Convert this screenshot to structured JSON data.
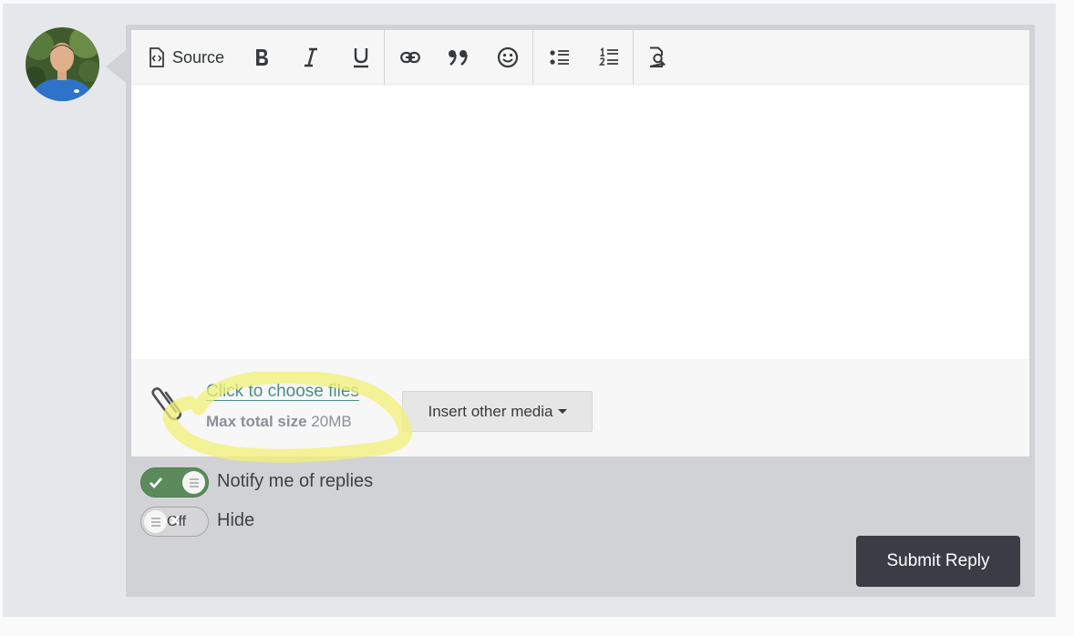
{
  "toolbar": {
    "source_label": "Source",
    "buttons": [
      "bold-icon",
      "italic-icon",
      "underline-icon",
      "link-icon",
      "quote-icon",
      "emoji-icon",
      "bullet-list-icon",
      "numbered-list-icon",
      "preview-icon"
    ]
  },
  "attachments": {
    "choose_files_label": "Click to choose files",
    "max_size_label": "Max total size",
    "max_size_value": "20MB",
    "insert_media_label": "Insert other media"
  },
  "options": {
    "notify_label": "Notify me of replies",
    "notify_enabled": true,
    "hide_label": "Hide",
    "hide_state_text": "Off",
    "hide_enabled": false
  },
  "submit_label": "Submit Reply",
  "colors": {
    "toggle_on": "#5b8a5b",
    "link": "#4d8d84",
    "submit_bg": "#3a3d44",
    "highlight": "#f2f076"
  }
}
